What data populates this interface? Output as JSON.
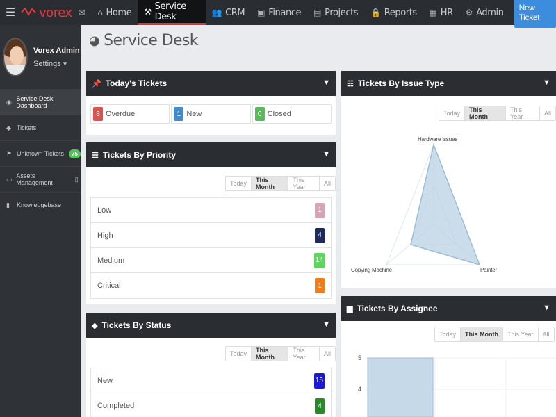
{
  "nav": {
    "brand": "vorex",
    "items": [
      {
        "label": "Home",
        "icon": "home-icon",
        "glyph": "⌂"
      },
      {
        "label": "Service Desk",
        "icon": "wrench-icon",
        "glyph": "⚒",
        "active": true
      },
      {
        "label": "CRM",
        "icon": "users-icon",
        "glyph": "👥"
      },
      {
        "label": "Finance",
        "icon": "money-icon",
        "glyph": "▣"
      },
      {
        "label": "Projects",
        "icon": "projects-icon",
        "glyph": "▤"
      },
      {
        "label": "Reports",
        "icon": "lock-icon",
        "glyph": "🔒"
      },
      {
        "label": "HR",
        "icon": "hr-icon",
        "glyph": "▦"
      },
      {
        "label": "Admin",
        "icon": "gear-icon",
        "glyph": "⚙"
      }
    ],
    "new_ticket": "New Ticket"
  },
  "sidebar": {
    "user_name": "Vorex Admin",
    "settings": "Settings ▾",
    "items": [
      {
        "label": "Service Desk Dashboard",
        "icon": "dashboard-icon",
        "glyph": "◉"
      },
      {
        "label": "Tickets",
        "icon": "ticket-icon",
        "glyph": "◆"
      },
      {
        "label": "Unknown Tickets",
        "icon": "flag-icon",
        "glyph": "⚑",
        "badge": "75"
      },
      {
        "label": "Assets Management",
        "icon": "laptop-icon",
        "glyph": "▭"
      },
      {
        "label": "Knowledgebase",
        "icon": "book-icon",
        "glyph": "▮"
      }
    ]
  },
  "page_title": "Service Desk",
  "filter_labels": [
    "Today",
    "This Month",
    "This Year",
    "All"
  ],
  "todays_tickets": {
    "title": "Today's Tickets",
    "cells": [
      {
        "count": "8",
        "label": "Overdue",
        "color": "#d9534f"
      },
      {
        "count": "1",
        "label": "New",
        "color": "#428bca"
      },
      {
        "count": "0",
        "label": "Closed",
        "color": "#5cb85c"
      }
    ]
  },
  "by_priority": {
    "title": "Tickets By Priority",
    "rows": [
      {
        "label": "Low",
        "count": "1",
        "color": "#d9a3b6"
      },
      {
        "label": "High",
        "count": "4",
        "color": "#1c2a5c"
      },
      {
        "label": "Medium",
        "count": "14",
        "color": "#5cd65c"
      },
      {
        "label": "Critical",
        "count": "1",
        "color": "#f07d1a"
      }
    ]
  },
  "by_status": {
    "title": "Tickets By Status",
    "rows": [
      {
        "label": "New",
        "count": "15",
        "color": "#1a1ad6"
      },
      {
        "label": "Completed",
        "count": "4",
        "color": "#2a8a2a"
      }
    ]
  },
  "by_issue_type": {
    "title": "Tickets By Issue Type",
    "labels": [
      "Hardware Issues",
      "Painter",
      "Copying Machine"
    ]
  },
  "by_assignee": {
    "title": "Tickets By Assignee",
    "y_ticks": [
      "5",
      "4"
    ]
  },
  "colors": {
    "topbar": "#2a2d31",
    "accent_red": "#d33",
    "new_ticket_blue": "#3c8dde",
    "chart_fill": "#b9d1e3"
  }
}
